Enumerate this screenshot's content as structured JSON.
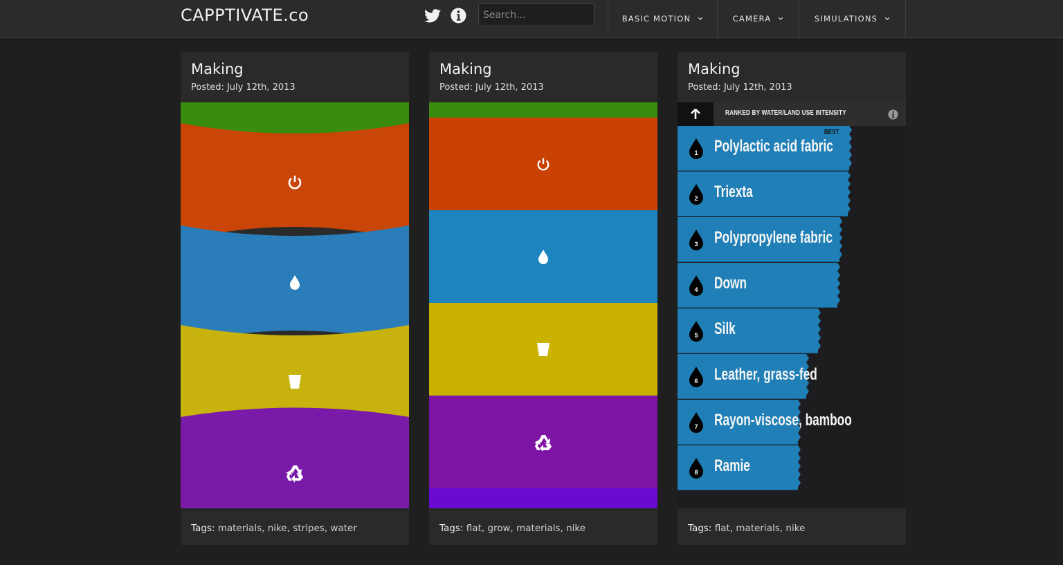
{
  "header": {
    "logo": "CAPPTIVATE.co",
    "search_placeholder": "Search...",
    "nav": [
      {
        "label": "BASIC MOTION"
      },
      {
        "label": "CAMERA"
      },
      {
        "label": "SIMULATIONS"
      }
    ]
  },
  "cards": [
    {
      "title": "Making",
      "date": "Posted: July 12th, 2013",
      "tags_label": "Tags:",
      "tags": [
        "materials",
        "nike",
        "stripes",
        "water"
      ],
      "bands": [
        {
          "color": "#3a8c0e",
          "icon": "none"
        },
        {
          "color": "#c94508",
          "icon": "power-icon"
        },
        {
          "color": "#2a7db8",
          "icon": "water-drop-icon"
        },
        {
          "color": "#c8b20d",
          "icon": "cup-icon"
        },
        {
          "color": "#7a1aa8",
          "icon": "recycle-icon"
        }
      ]
    },
    {
      "title": "Making",
      "date": "Posted: July 12th, 2013",
      "tags_label": "Tags:",
      "tags": [
        "flat",
        "grow",
        "materials",
        "nike"
      ],
      "bands": [
        {
          "color": "#3a8c0e",
          "icon": "none"
        },
        {
          "color": "#c94204",
          "icon": "power-icon"
        },
        {
          "color": "#1e84bf",
          "icon": "water-drop-icon"
        },
        {
          "color": "#c9b300",
          "icon": "cup-icon"
        },
        {
          "color": "#7e14a6",
          "icon": "recycle-icon"
        },
        {
          "color": "#6a0ad0",
          "icon": "none"
        }
      ]
    },
    {
      "title": "Making",
      "date": "Posted: July 12th, 2013",
      "tags_label": "Tags:",
      "tags": [
        "flat",
        "materials",
        "nike"
      ],
      "ranking_label": "RANKED BY WATER/LAND USE INTENSITY",
      "best_label": "BEST",
      "items": [
        {
          "rank": "1",
          "name": "Polylactic acid fabric"
        },
        {
          "rank": "2",
          "name": "Triexta"
        },
        {
          "rank": "3",
          "name": "Polypropylene fabric"
        },
        {
          "rank": "4",
          "name": "Down"
        },
        {
          "rank": "5",
          "name": "Silk"
        },
        {
          "rank": "6",
          "name": "Leather, grass-fed"
        },
        {
          "rank": "7",
          "name": "Rayon-viscose, bamboo"
        },
        {
          "rank": "8",
          "name": "Ramie"
        }
      ],
      "colors": {
        "bar": "#1f7fb6",
        "list_bg": "#1d1d1f"
      }
    }
  ]
}
